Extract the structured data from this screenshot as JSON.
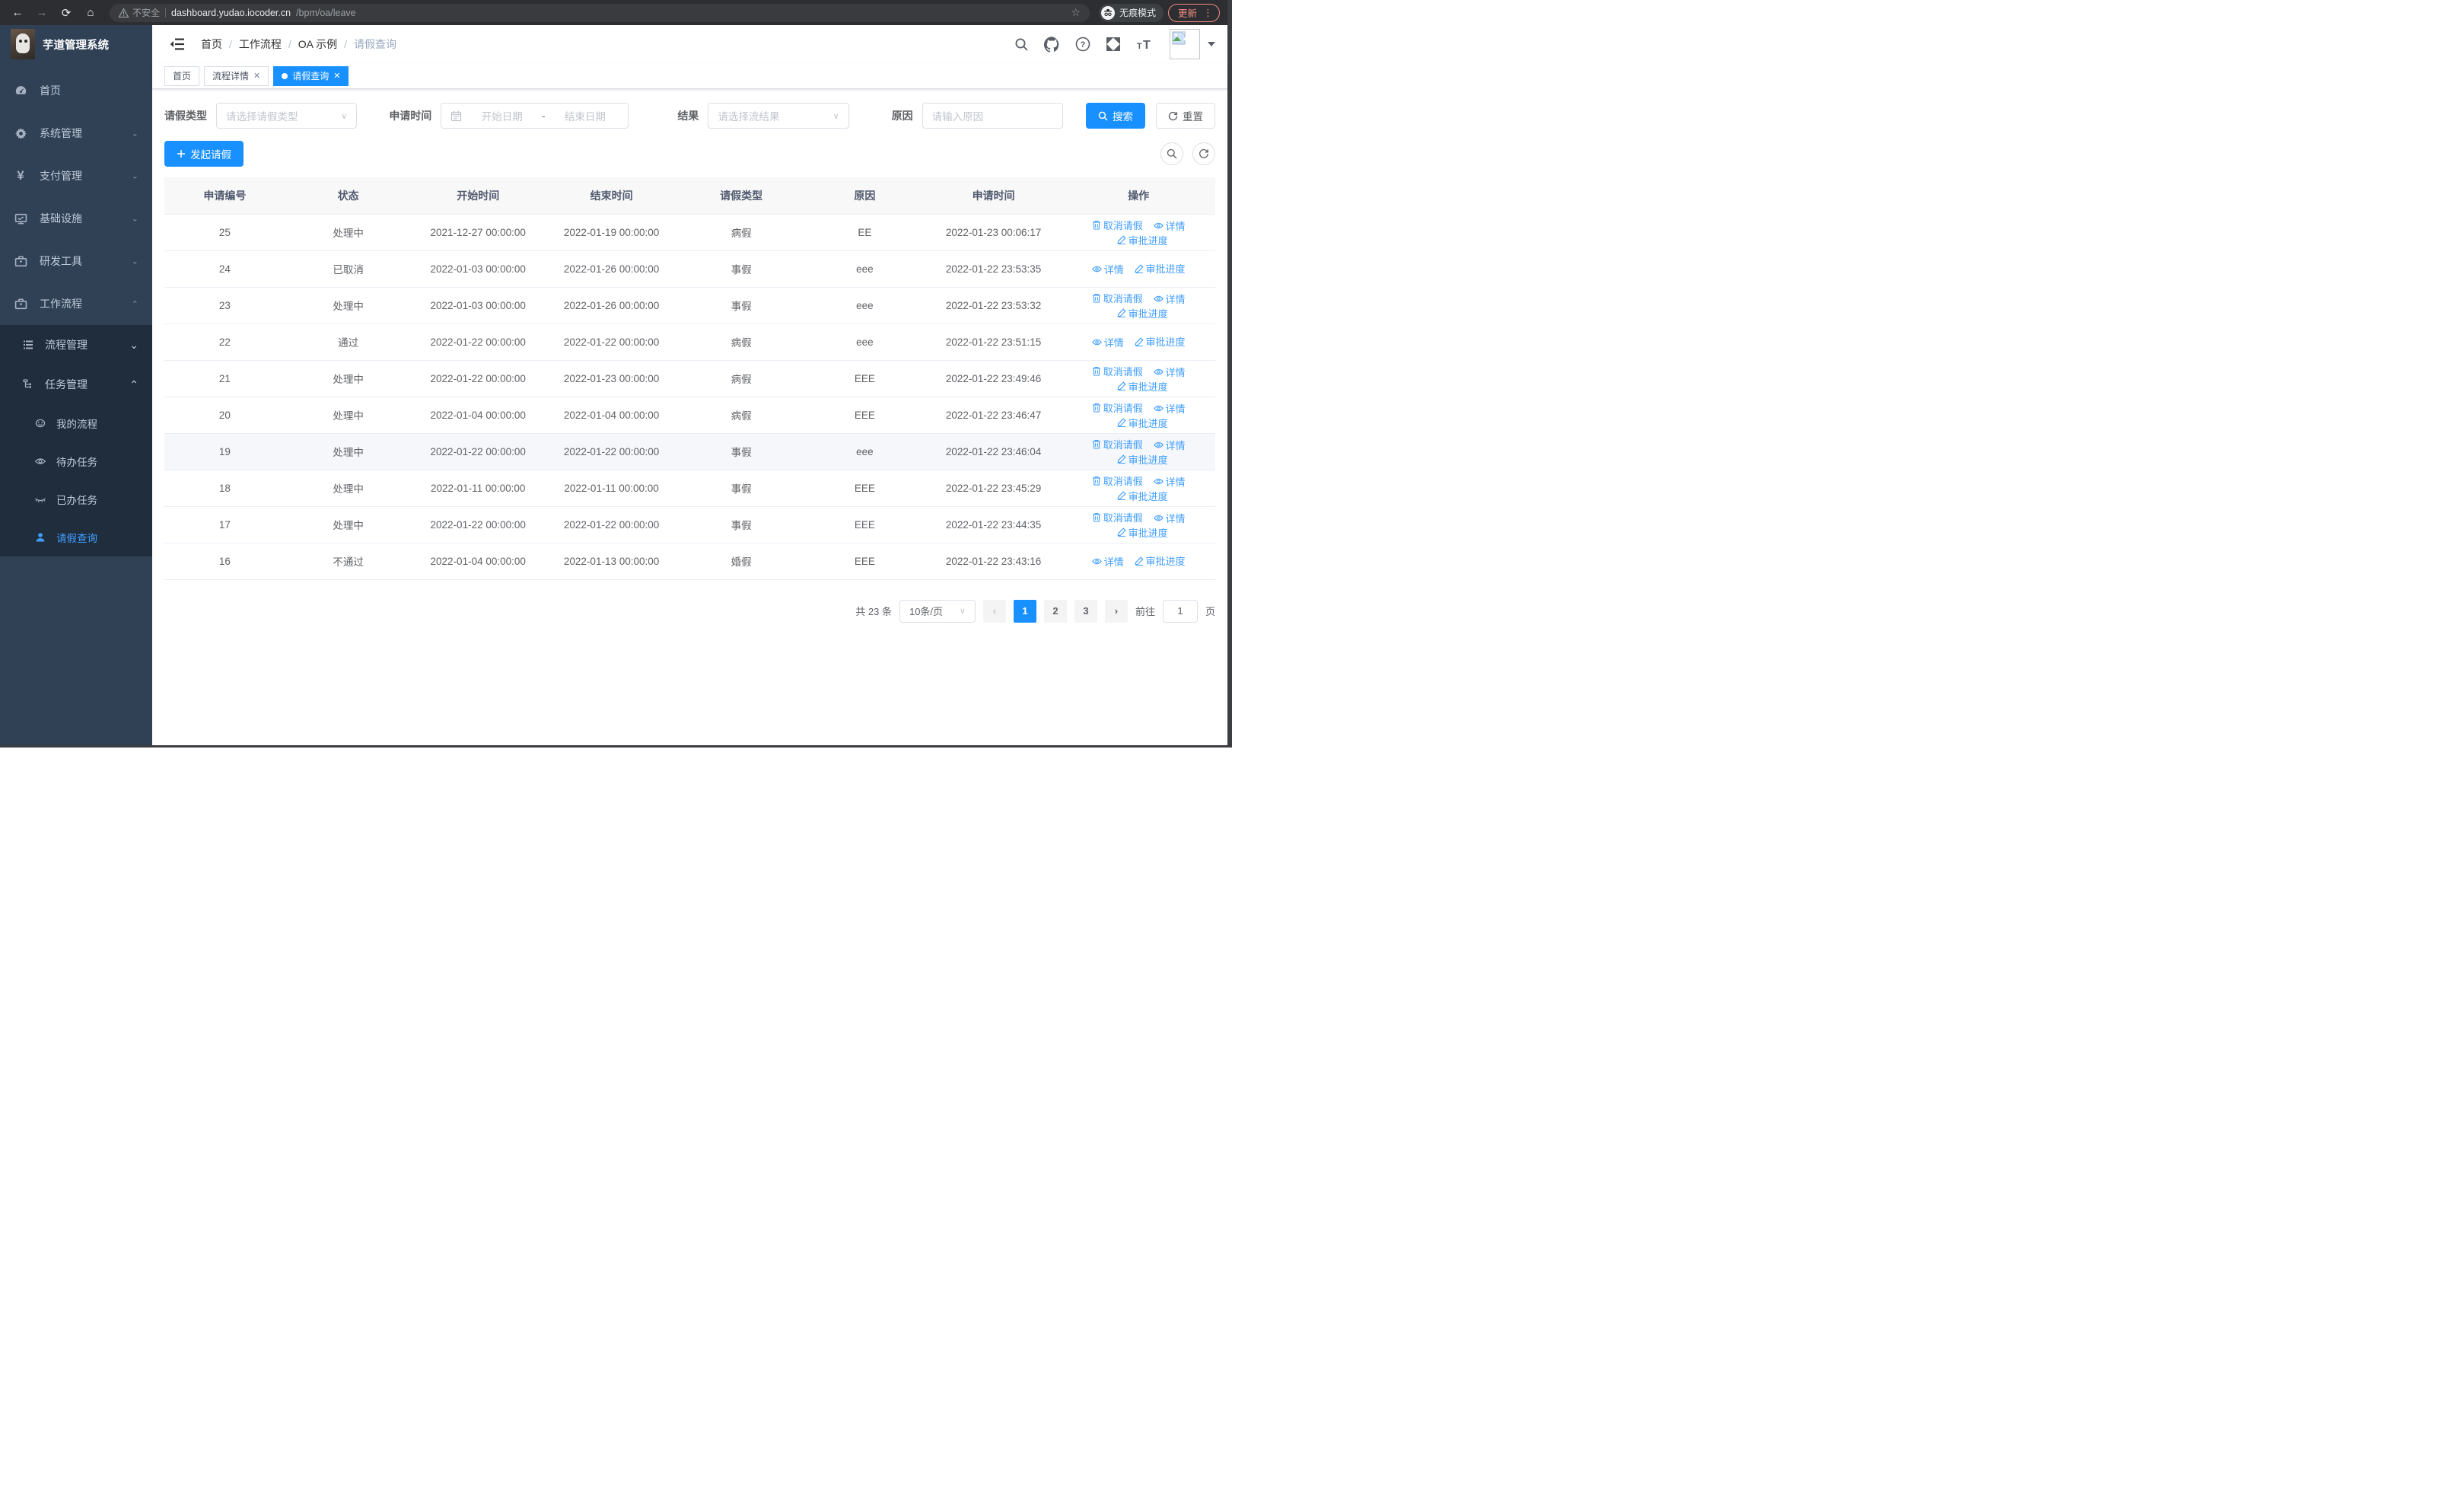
{
  "colors": {
    "accent": "#1890ff",
    "sidebar_bg": "#304156",
    "submenu_bg": "#1f2d3d",
    "sidebar_active": "#409eff",
    "update_warn": "#f28b82"
  },
  "browser": {
    "security_warning": "不安全",
    "url_host": "dashboard.yudao.iocoder.cn",
    "url_path": "/bpm/oa/leave",
    "incognito_label": "无痕模式",
    "update_label": "更新"
  },
  "app": {
    "title": "芋道管理系统"
  },
  "breadcrumb": {
    "separator": "/",
    "items": [
      "首页",
      "工作流程",
      "OA 示例",
      "请假查询"
    ]
  },
  "tabs": [
    {
      "label": "首页"
    },
    {
      "label": "流程详情"
    },
    {
      "label": "请假查询"
    }
  ],
  "sidebar": {
    "items": [
      {
        "label": "首页"
      },
      {
        "label": "系统管理"
      },
      {
        "label": "支付管理"
      },
      {
        "label": "基础设施"
      },
      {
        "label": "研发工具"
      },
      {
        "label": "工作流程"
      }
    ],
    "submenu": [
      {
        "label": "流程管理"
      },
      {
        "label": "任务管理"
      }
    ],
    "tasks": [
      {
        "label": "我的流程"
      },
      {
        "label": "待办任务"
      },
      {
        "label": "已办任务"
      },
      {
        "label": "请假查询"
      }
    ]
  },
  "filters": {
    "leave_type_label": "请假类型",
    "leave_type_placeholder": "请选择请假类型",
    "apply_time_label": "申请时间",
    "start_date_placeholder": "开始日期",
    "date_separator": "-",
    "end_date_placeholder": "结束日期",
    "result_label": "结果",
    "result_placeholder": "请选择流结果",
    "reason_label": "原因",
    "reason_placeholder": "请输入原因",
    "search_label": "搜索",
    "reset_label": "重置"
  },
  "toolbar": {
    "create_label": "发起请假"
  },
  "table": {
    "headers": [
      "申请编号",
      "状态",
      "开始时间",
      "结束时间",
      "请假类型",
      "原因",
      "申请时间",
      "操作"
    ],
    "action_labels": {
      "cancel": "取消请假",
      "detail": "详情",
      "progress": "审批进度"
    },
    "rows": [
      {
        "id": "25",
        "status": "处理中",
        "start": "2021-12-27 00:00:00",
        "end": "2022-01-19 00:00:00",
        "type": "病假",
        "reason": "EE",
        "apply_time": "2022-01-23 00:06:17",
        "cancelable": true,
        "highlight": false
      },
      {
        "id": "24",
        "status": "已取消",
        "start": "2022-01-03 00:00:00",
        "end": "2022-01-26 00:00:00",
        "type": "事假",
        "reason": "eee",
        "apply_time": "2022-01-22 23:53:35",
        "cancelable": false,
        "highlight": false
      },
      {
        "id": "23",
        "status": "处理中",
        "start": "2022-01-03 00:00:00",
        "end": "2022-01-26 00:00:00",
        "type": "事假",
        "reason": "eee",
        "apply_time": "2022-01-22 23:53:32",
        "cancelable": true,
        "highlight": false
      },
      {
        "id": "22",
        "status": "通过",
        "start": "2022-01-22 00:00:00",
        "end": "2022-01-22 00:00:00",
        "type": "病假",
        "reason": "eee",
        "apply_time": "2022-01-22 23:51:15",
        "cancelable": false,
        "highlight": false
      },
      {
        "id": "21",
        "status": "处理中",
        "start": "2022-01-22 00:00:00",
        "end": "2022-01-23 00:00:00",
        "type": "病假",
        "reason": "EEE",
        "apply_time": "2022-01-22 23:49:46",
        "cancelable": true,
        "highlight": false
      },
      {
        "id": "20",
        "status": "处理中",
        "start": "2022-01-04 00:00:00",
        "end": "2022-01-04 00:00:00",
        "type": "病假",
        "reason": "EEE",
        "apply_time": "2022-01-22 23:46:47",
        "cancelable": true,
        "highlight": false
      },
      {
        "id": "19",
        "status": "处理中",
        "start": "2022-01-22 00:00:00",
        "end": "2022-01-22 00:00:00",
        "type": "事假",
        "reason": "eee",
        "apply_time": "2022-01-22 23:46:04",
        "cancelable": true,
        "highlight": true
      },
      {
        "id": "18",
        "status": "处理中",
        "start": "2022-01-11 00:00:00",
        "end": "2022-01-11 00:00:00",
        "type": "事假",
        "reason": "EEE",
        "apply_time": "2022-01-22 23:45:29",
        "cancelable": true,
        "highlight": false
      },
      {
        "id": "17",
        "status": "处理中",
        "start": "2022-01-22 00:00:00",
        "end": "2022-01-22 00:00:00",
        "type": "事假",
        "reason": "EEE",
        "apply_time": "2022-01-22 23:44:35",
        "cancelable": true,
        "highlight": false
      },
      {
        "id": "16",
        "status": "不通过",
        "start": "2022-01-04 00:00:00",
        "end": "2022-01-13 00:00:00",
        "type": "婚假",
        "reason": "EEE",
        "apply_time": "2022-01-22 23:43:16",
        "cancelable": false,
        "highlight": false
      }
    ]
  },
  "pagination": {
    "total_label": "共 23 条",
    "page_size": "10条/页",
    "pages": [
      "1",
      "2",
      "3"
    ],
    "active_page": "1",
    "goto_label": "前往",
    "goto_value": "1",
    "unit_label": "页"
  }
}
